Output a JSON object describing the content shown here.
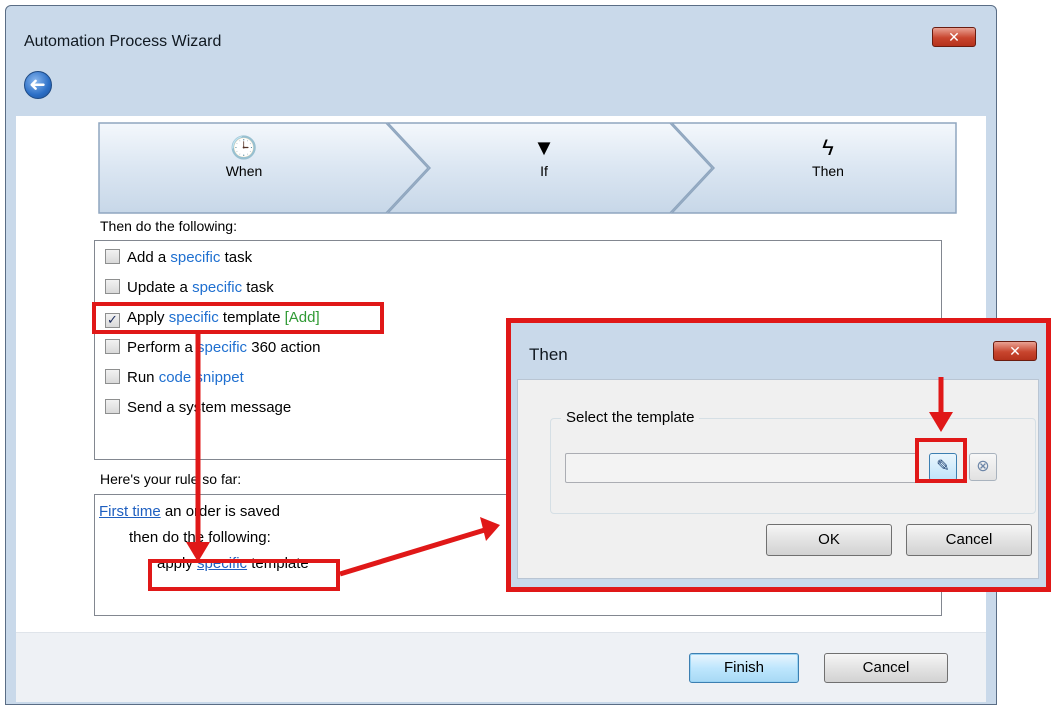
{
  "window": {
    "title": "Automation Process Wizard",
    "close_label": "✕",
    "back_glyph": "➜"
  },
  "steps": [
    {
      "label": "When",
      "icon": "clock-icon",
      "glyph": "🕒"
    },
    {
      "label": "If",
      "icon": "filter-icon",
      "glyph": "▼"
    },
    {
      "label": "Then",
      "icon": "lightning-icon",
      "glyph": "ϟ"
    }
  ],
  "actions": {
    "heading": "Then do the following:",
    "items": [
      {
        "pre": "Add a",
        "link": "specific",
        "post": "task",
        "extra": "",
        "checked": false,
        "check_glyph": ""
      },
      {
        "pre": "Update a",
        "link": "specific",
        "post": "task",
        "extra": "",
        "checked": false,
        "check_glyph": ""
      },
      {
        "pre": "Apply",
        "link": "specific",
        "post": "template",
        "extra": "[Add]",
        "checked": true,
        "check_glyph": "✓"
      },
      {
        "pre": "Perform a",
        "link": "specific",
        "post": "360 action",
        "extra": "",
        "checked": false,
        "check_glyph": ""
      },
      {
        "pre": "Run",
        "link": "code snippet",
        "post": "",
        "extra": "",
        "checked": false,
        "check_glyph": ""
      },
      {
        "pre": "Send a system message",
        "link": "",
        "post": "",
        "extra": "",
        "checked": false,
        "check_glyph": ""
      }
    ]
  },
  "rule": {
    "heading": "Here's your rule so far:",
    "line1_link": "First time",
    "line1_text": "an order is saved",
    "line2": "then do the following:",
    "line3_pre": "apply",
    "line3_link": "specific",
    "line3_post": "template"
  },
  "footer": {
    "finish_label": "Finish",
    "cancel_label": "Cancel"
  },
  "dialog": {
    "title": "Then",
    "close_label": "✕",
    "group_label": "Select the template",
    "template_value": "",
    "pick_glyph": "✎",
    "clear_glyph": "⊗",
    "ok_label": "OK",
    "cancel_label": "Cancel"
  },
  "colors": {
    "annotation": "#e01818",
    "link": "#1e6fd0",
    "add_link": "#2f9a34",
    "window_frame": "#c9d9ea"
  }
}
